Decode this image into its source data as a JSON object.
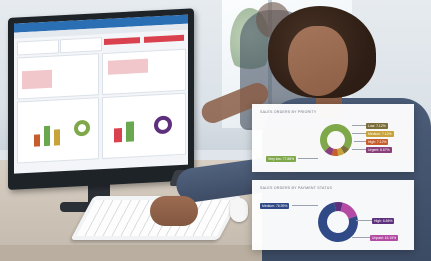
{
  "scene": "office worker analysing dashboard",
  "card1": {
    "title": "SALES ORDERS BY PRIORITY",
    "legend": [
      {
        "label": "Low: 7.12%",
        "color": "#7a6f3a"
      },
      {
        "label": "Medium: 7.12%",
        "color": "#c8a33b"
      },
      {
        "label": "High: 7.12%",
        "color": "#c75d2c"
      },
      {
        "label": "Urgent: 8.67%",
        "color": "#8a3e7a"
      },
      {
        "label": "Very low: 77.88%",
        "color": "#7fa84a"
      }
    ]
  },
  "card2": {
    "title": "SALES ORDERS BY PAYMENT STATUS",
    "legend": [
      {
        "label": "Medium: 76.99%",
        "color": "#2f4a86"
      },
      {
        "label": "High: 6.86%",
        "color": "#5e2f7d"
      },
      {
        "label": "Unpaid: 16.15%",
        "color": "#b44aa3"
      }
    ]
  },
  "chart_data": [
    {
      "type": "pie",
      "title": "SALES ORDERS BY PRIORITY",
      "categories": [
        "Very low",
        "Low",
        "Medium",
        "High",
        "Urgent"
      ],
      "values": [
        77.88,
        7.12,
        7.12,
        7.12,
        8.67
      ]
    },
    {
      "type": "pie",
      "title": "SALES ORDERS BY PAYMENT STATUS",
      "categories": [
        "Medium",
        "High",
        "Unpaid"
      ],
      "values": [
        76.99,
        6.86,
        16.15
      ]
    }
  ]
}
